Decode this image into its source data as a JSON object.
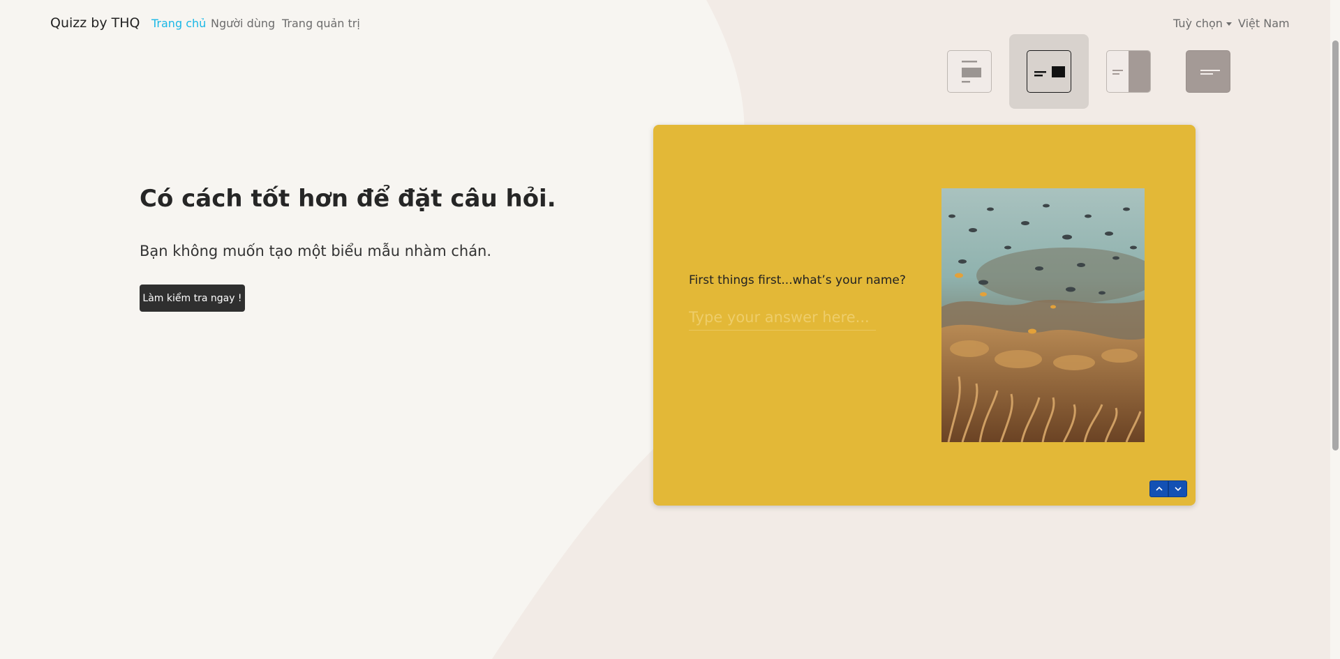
{
  "navbar": {
    "brand": "Quizz by THQ",
    "links": [
      {
        "label": "Trang chủ",
        "active": true
      },
      {
        "label": "Người dùng",
        "active": false
      },
      {
        "label": "Trang quản trị",
        "active": false
      }
    ],
    "options_label": "Tuỳ chọn",
    "language_label": "Việt Nam"
  },
  "hero": {
    "title": "Có cách tốt hơn để đặt câu hỏi.",
    "subtitle": "Bạn không muốn tạo một biểu mẫu nhàm chán.",
    "cta_label": "Làm kiểm tra ngay !"
  },
  "layout_options": {
    "icons": [
      "layout-stacked-icon",
      "layout-split-image-right-icon",
      "layout-image-panel-right-icon",
      "layout-text-only-icon"
    ],
    "selected_index": 1
  },
  "quiz": {
    "question": "First things first...what’s your name?",
    "answer_placeholder": "Type your answer here...",
    "answer_value": "",
    "image_description_icon": "coral-reef-photo",
    "nav_icons": [
      "chevron-up-icon",
      "chevron-down-icon"
    ]
  },
  "colors": {
    "card_bg": "#e3b837",
    "accent_link": "#19b7e6",
    "nav_buttons": "#1351b4",
    "cta_bg": "#2f2f2f",
    "page_bg": "#f7f5f1",
    "blob_bg": "#f2ebe6"
  }
}
